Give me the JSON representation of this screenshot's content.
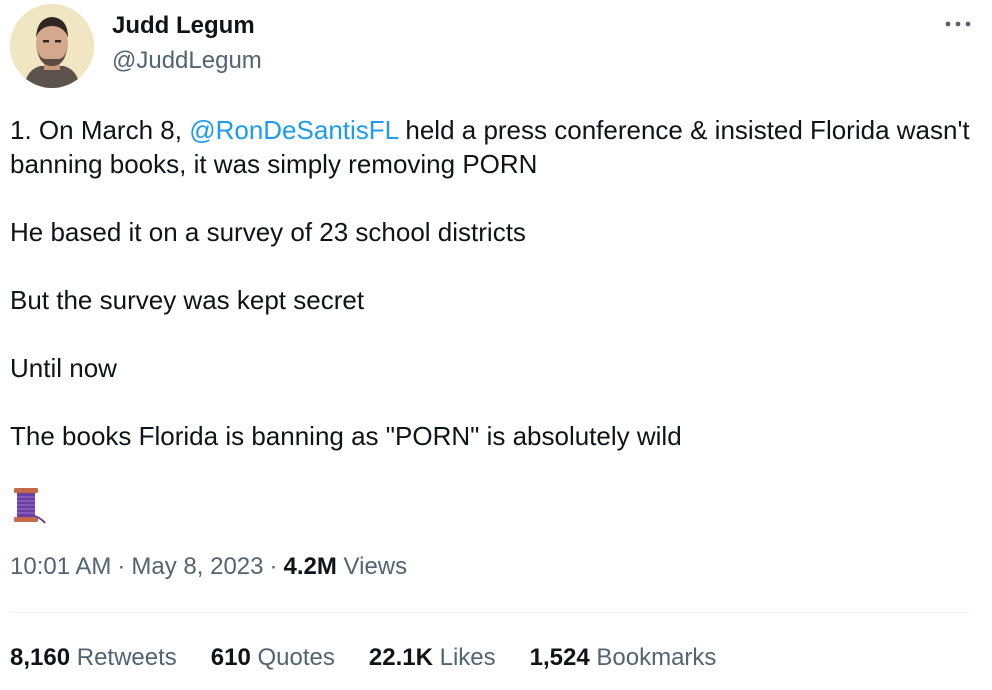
{
  "author": {
    "name": "Judd Legum",
    "handle": "@JuddLegum"
  },
  "more_icon": "more-horizontal-icon",
  "tweet": {
    "line1_prefix": "1. On March 8, ",
    "mention": "@RonDeSantisFL",
    "line1_suffix": " held a press conference & insisted Florida wasn't banning books, it was simply removing PORN",
    "p2": "He based it on a survey of 23 school districts",
    "p3": "But the survey was kept secret",
    "p4": "Until now",
    "p5": "The books Florida is banning as \"PORN\" is absolutely wild",
    "emoji_icon": "thread-spool-icon"
  },
  "meta": {
    "time": "10:01 AM",
    "date": "May 8, 2023",
    "views_count": "4.2M",
    "views_label": "Views"
  },
  "stats": {
    "retweets_count": "8,160",
    "retweets_label": "Retweets",
    "quotes_count": "610",
    "quotes_label": "Quotes",
    "likes_count": "22.1K",
    "likes_label": "Likes",
    "bookmarks_count": "1,524",
    "bookmarks_label": "Bookmarks"
  },
  "colors": {
    "link": "#1d9bf0",
    "text": "#0f1419",
    "secondary": "#536471",
    "divider": "#eff3f4"
  }
}
